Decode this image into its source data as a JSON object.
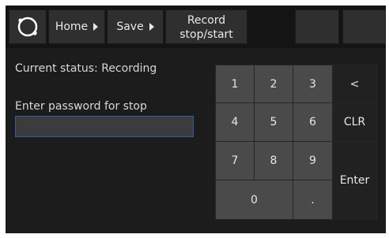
{
  "toolbar": {
    "logo_icon": "circle-ring-icon",
    "home_label": "Home",
    "save_label": "Save",
    "record_label_line1": "Record",
    "record_label_line2": "stop/start",
    "arrow_icon": "triangle-right-icon"
  },
  "status": {
    "text": "Current status: Recording"
  },
  "password": {
    "label": "Enter password for stop",
    "value": "",
    "placeholder": ""
  },
  "keypad": {
    "k1": "1",
    "k2": "2",
    "k3": "3",
    "k4": "4",
    "k5": "5",
    "k6": "6",
    "k7": "7",
    "k8": "8",
    "k9": "9",
    "k0": "0",
    "dot": ".",
    "backspace": "<",
    "clear": "CLR",
    "enter": "Enter"
  },
  "colors": {
    "background": "#1c1c1c",
    "key_light": "#4a4a4a",
    "key_dark": "#212121",
    "input_border": "#355aa6"
  }
}
